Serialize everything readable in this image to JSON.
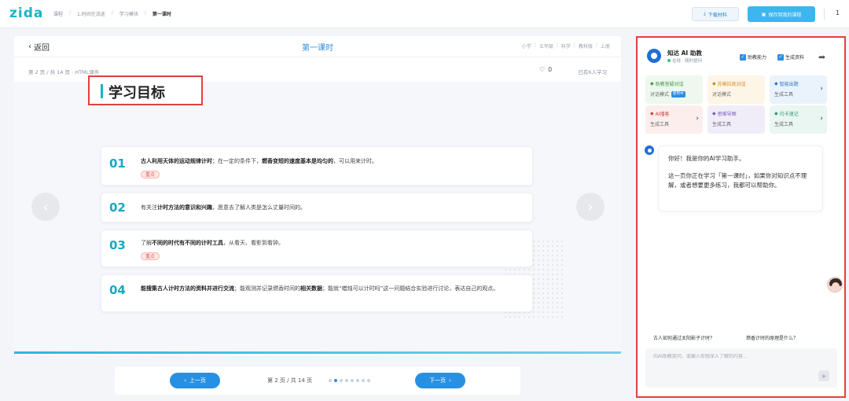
{
  "header": {
    "logo": "zida",
    "breadcrumb": [
      "课程",
      "1.时间在流逝",
      "学习模块",
      "第一课时"
    ],
    "download_label": "下载材料",
    "save_label": "保存到我的课程",
    "user_number": "1"
  },
  "lesson": {
    "back_label": "返回",
    "title": "第一课时",
    "tags": [
      "小学",
      "五年级",
      "科学",
      "教科版",
      "上册"
    ],
    "page_info": "第 2 页 / 共 14 页 · HTML课件",
    "likes": "0",
    "learners": "已有6人学习"
  },
  "slide": {
    "heading": "学习目标",
    "badge_label": "重点",
    "objectives": [
      {
        "num": "01",
        "bold": "古人利用天体的运动规律计时",
        "mid": "；在一定的条件下，",
        "bold2": "燃香变短的速度基本是均匀的",
        "tail": "，可以用来计时。",
        "badge": true
      },
      {
        "num": "02",
        "pre": "有关注",
        "bold": "计时方法的意识和兴趣",
        "tail": "，愿意去了解人类是怎么丈量时间的。",
        "badge": false
      },
      {
        "num": "03",
        "pre": "了解",
        "bold": "不同的时代有不同的计时工具",
        "tail": "，从看天、看影到看钟。",
        "badge": true
      },
      {
        "num": "04",
        "bold": "能搜集古人计时方法的资料并进行交流",
        "mid": "；能观测并记录燃香时间的",
        "bold2": "相关数据",
        "tail": "；能就“蜡烛可以计时吗”这一问题结合实验进行讨论，表达自己的观点。",
        "badge": false
      }
    ]
  },
  "pager": {
    "prev_label": "上一页",
    "next_label": "下一页",
    "info": "第 2 页 / 共 14 页",
    "active_dot": 1,
    "dot_count": 8
  },
  "assistant": {
    "name": "知达 AI 助教",
    "status": "在线 · 随时提问",
    "opt1": "助教能力",
    "opt2": "生成资料",
    "tools": [
      {
        "title": "助教答疑对话",
        "sub": "对话模式",
        "tag": "使用中",
        "bg": "#eef8ee",
        "color": "#3f9a4a"
      },
      {
        "title": "苏格拉底对话",
        "sub": "对话模式",
        "tag": "",
        "bg": "#fdf5e6",
        "color": "#d08a1e"
      },
      {
        "title": "智能出题",
        "sub": "生成工具",
        "tag": "",
        "bg": "#eaf3fb",
        "color": "#2b78c4"
      },
      {
        "title": "AI播客",
        "sub": "生成工具",
        "tag": "",
        "bg": "#fdeeee",
        "color": "#d2473e"
      },
      {
        "title": "思维导图",
        "sub": "生成工具",
        "tag": "",
        "bg": "#f1edf8",
        "color": "#7a5ab7"
      },
      {
        "title": "闪卡速记",
        "sub": "生成工具",
        "tag": "",
        "bg": "#e9f6f1",
        "color": "#2d9a72"
      }
    ],
    "greeting": "你好！我是你的AI学习助手。",
    "message": "这一页你正在学习「第一课时」，如果你对知识点不理解，或者想要更多练习，我都可以帮助你。",
    "suggestions": [
      "古人如何通过太阳影子计时？",
      "燃香计时的原理是什么？"
    ],
    "input_placeholder": "向AI助教提问，或输入你想深入了解的内容..."
  },
  "colors": {
    "brand": "#19b4c8",
    "accent_blue": "#2890e3",
    "highlight_red": "#e0423c"
  }
}
